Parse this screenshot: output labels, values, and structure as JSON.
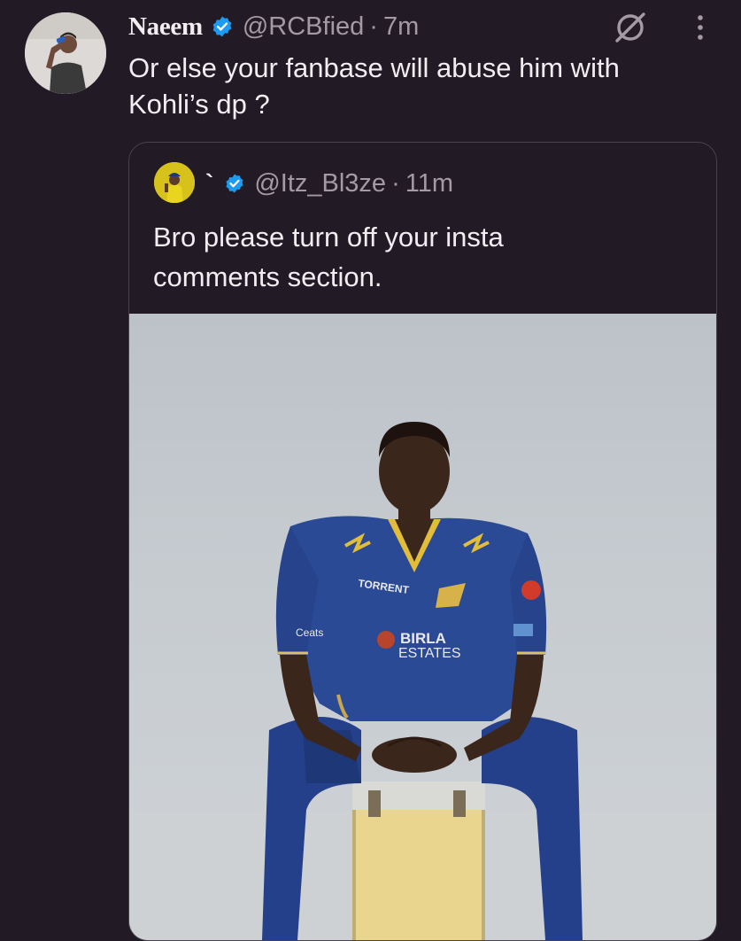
{
  "tweet": {
    "author_name": "Naeem",
    "handle": "@RCBfied",
    "separator": "·",
    "time": "7m",
    "text_lines": [
      "Or else your fanbase will abuse him with",
      "Kohli’s dp ?"
    ]
  },
  "quoted": {
    "author_name": "`",
    "handle": "@Itz_Bl3ze",
    "separator": "·",
    "time": "11m",
    "text_lines": [
      "Bro please turn off your insta",
      "comments section."
    ],
    "image": {
      "jersey_text_1": "TORRENT",
      "jersey_text_2": "BIRLA",
      "jersey_text_3": "ESTATES",
      "jersey_text_4": "Ceats"
    }
  },
  "colors": {
    "background": "#221b26",
    "verified": "#1d9bf0",
    "secondary_text": "#a39aa3",
    "border": "#4a4150"
  },
  "icons": [
    "verified-badge-icon",
    "grok-icon",
    "more-options-icon"
  ]
}
